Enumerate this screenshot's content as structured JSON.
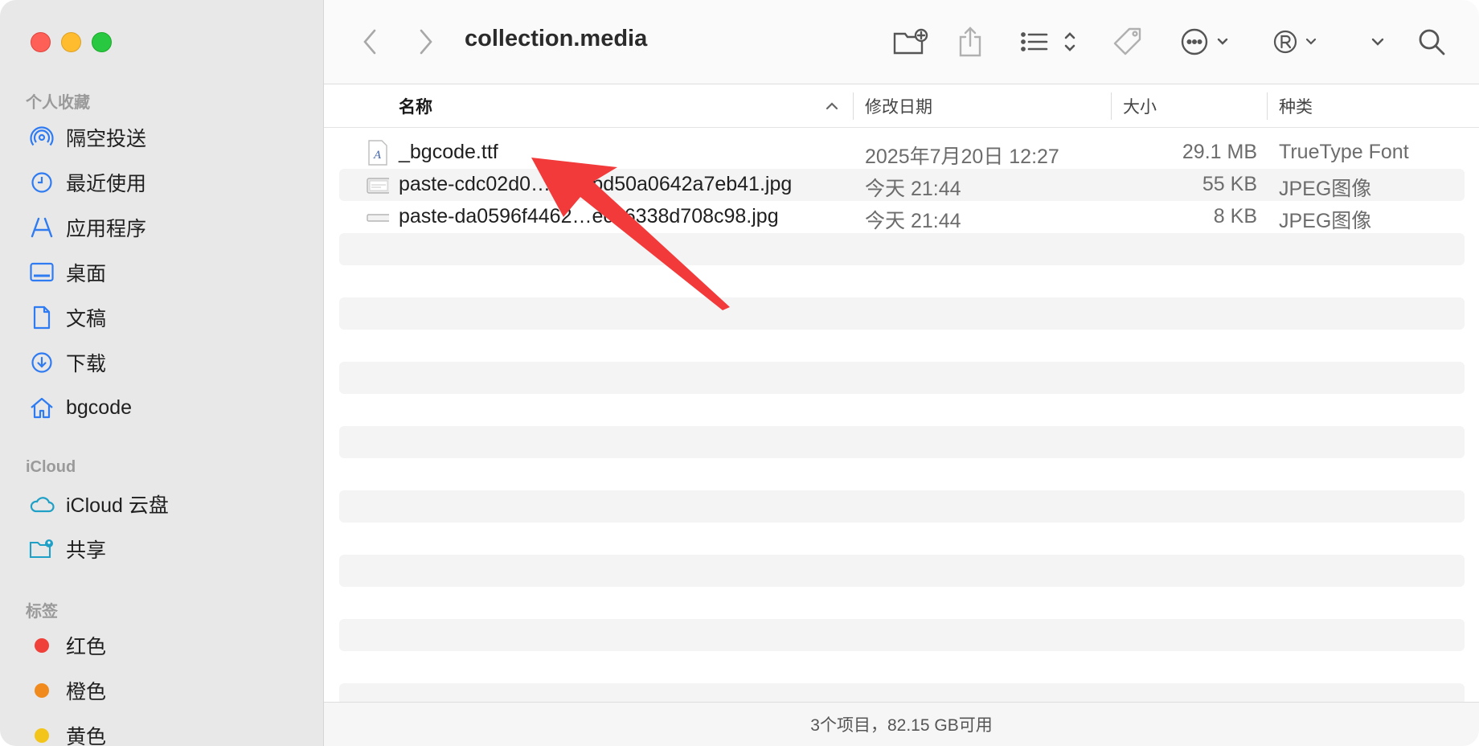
{
  "window": {
    "title": "collection.media"
  },
  "sidebar": {
    "sections": [
      {
        "title": "个人收藏",
        "items": [
          {
            "label": "隔空投送",
            "icon": "airdrop-icon"
          },
          {
            "label": "最近使用",
            "icon": "clock-icon"
          },
          {
            "label": "应用程序",
            "icon": "applications-icon"
          },
          {
            "label": "桌面",
            "icon": "desktop-icon"
          },
          {
            "label": "文稿",
            "icon": "document-icon"
          },
          {
            "label": "下载",
            "icon": "download-icon"
          },
          {
            "label": "bgcode",
            "icon": "home-icon"
          }
        ]
      },
      {
        "title": "iCloud",
        "items": [
          {
            "label": "iCloud 云盘",
            "icon": "cloud-icon"
          },
          {
            "label": "共享",
            "icon": "shared-folder-icon"
          }
        ]
      },
      {
        "title": "标签",
        "items": [
          {
            "label": "红色",
            "color": "#f0403a"
          },
          {
            "label": "橙色",
            "color": "#f08a1c"
          },
          {
            "label": "黄色",
            "color": "#f3c41a"
          }
        ]
      }
    ]
  },
  "toolbar": {
    "icons": [
      "back-icon",
      "forward-icon",
      "new-folder-icon",
      "share-icon",
      "view-list-icon",
      "tag-icon",
      "more-actions-icon",
      "r-extension-icon",
      "chevron-down-icon",
      "search-icon"
    ]
  },
  "columns": {
    "name": "名称",
    "date": "修改日期",
    "size": "大小",
    "kind": "种类"
  },
  "files": [
    {
      "name": "_bgcode.ttf",
      "date": "2025年7月20日 12:27",
      "size": "29.1 MB",
      "kind": "TrueType Font"
    },
    {
      "name": "paste-cdc02d0…ca…bd50a0642a7eb41.jpg",
      "date": "今天 21:44",
      "size": "55 KB",
      "kind": "JPEG图像"
    },
    {
      "name": "paste-da0596f4462…ec26338d708c98.jpg",
      "date": "今天 21:44",
      "size": "8 KB",
      "kind": "JPEG图像"
    }
  ],
  "status": "3个项目，82.15 GB可用",
  "annotation": {
    "color": "#f23a3a"
  }
}
